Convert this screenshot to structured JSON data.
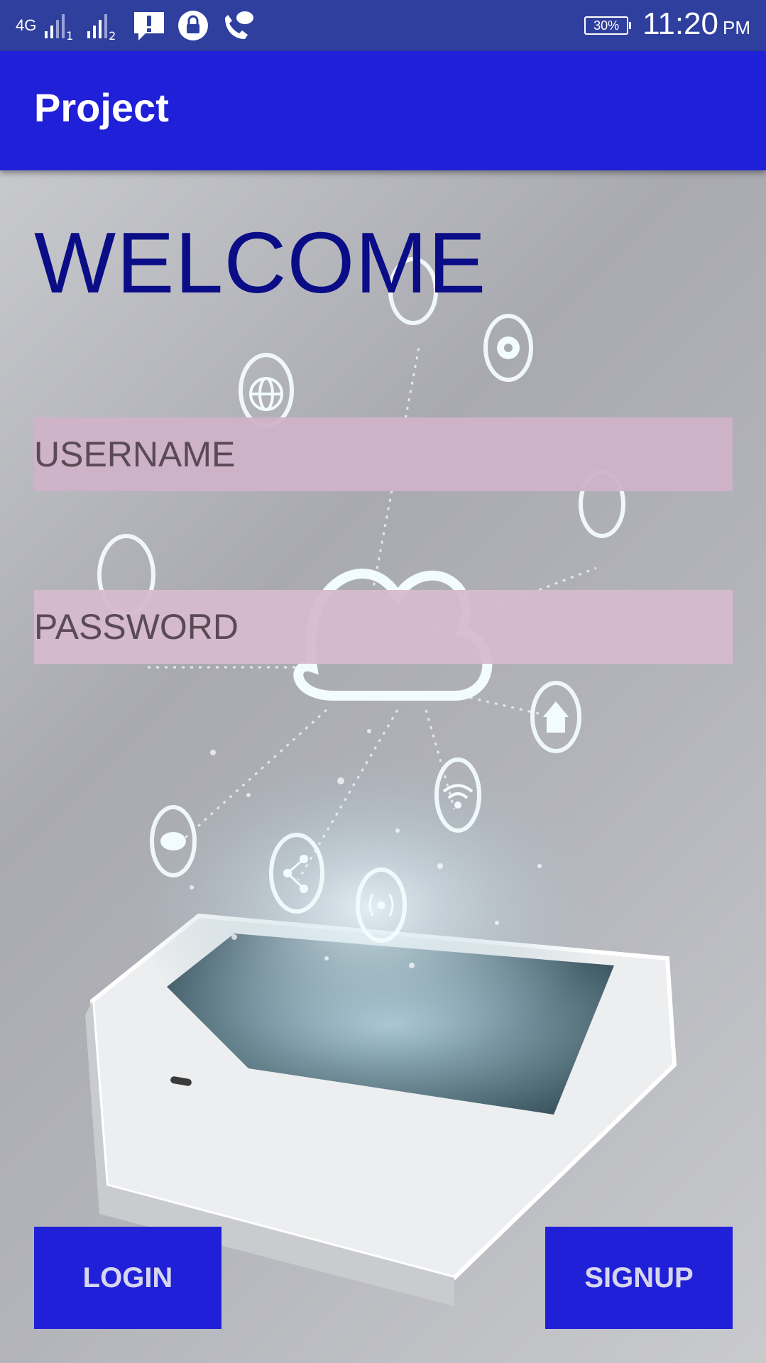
{
  "status_bar": {
    "network": "4G",
    "sim1_label": "1",
    "sim2_label": "2",
    "icons": [
      "signal-sim1-icon",
      "signal-sim2-icon",
      "alert-icon",
      "lock-icon",
      "call-icon"
    ],
    "battery": "30%",
    "time": "11:20",
    "ampm": "PM"
  },
  "app_bar": {
    "title": "Project"
  },
  "main": {
    "welcome": "WELCOME",
    "username_placeholder": "USERNAME",
    "password_placeholder": "PASSWORD"
  },
  "actions": {
    "login_label": "LOGIN",
    "signup_label": "SIGNUP"
  },
  "colors": {
    "status_bar": "#2f3f9e",
    "app_bar": "#2020d8",
    "welcome_text": "#0a0d86",
    "field_bg": "#d0b2c8",
    "button_bg": "#2020d8"
  }
}
